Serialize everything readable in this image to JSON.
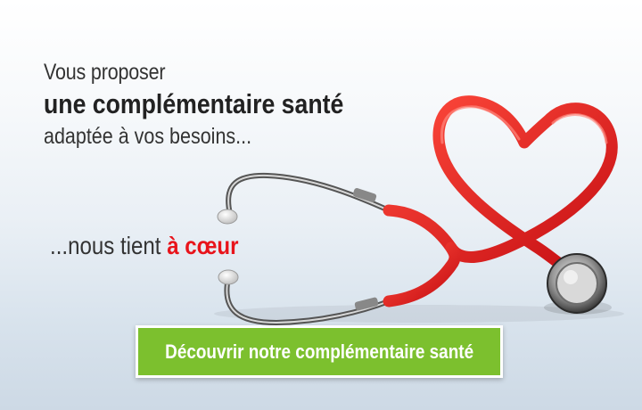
{
  "headline": {
    "line1": "Vous proposer",
    "line2": "une complémentaire santé",
    "line3": "adaptée à vos besoins..."
  },
  "tagline": {
    "prefix": "...nous tient ",
    "accent": "à cœur"
  },
  "cta": {
    "label": "Découvrir notre complémentaire santé"
  },
  "colors": {
    "accent_red": "#e8141b",
    "cta_green": "#7cc02e",
    "text": "#333333"
  },
  "icons": {
    "illustration": "stethoscope-heart-icon"
  }
}
